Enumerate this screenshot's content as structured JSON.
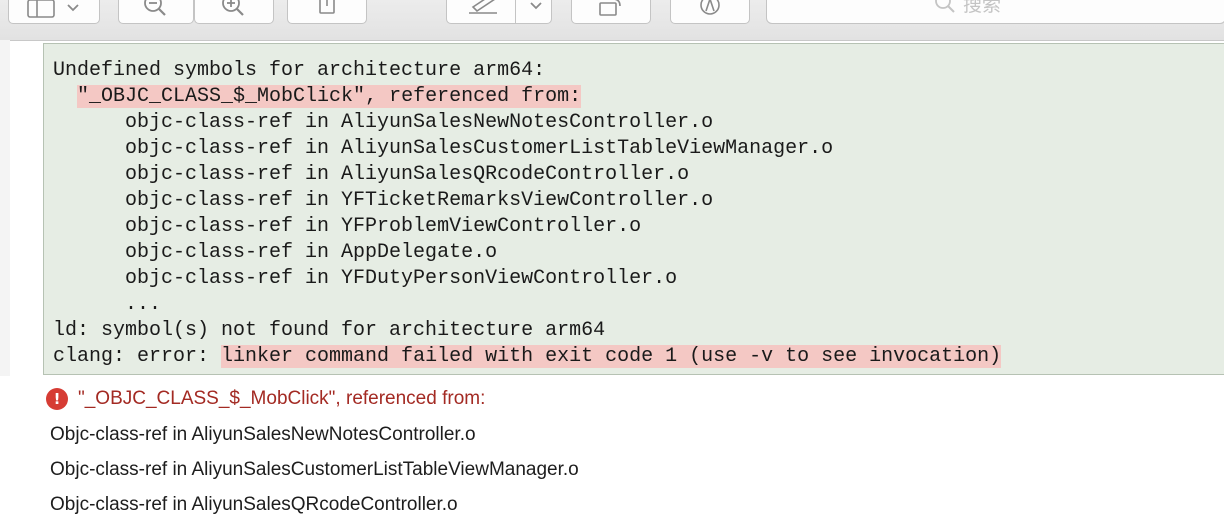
{
  "toolbar": {
    "search_placeholder": "搜索",
    "buttons": [
      "sidebar-toggle",
      "zoom-out",
      "zoom-in",
      "share",
      "markup",
      "rotate",
      "annotate"
    ]
  },
  "console": {
    "lines": [
      "Undefined symbols for architecture arm64:",
      "  \"_OBJC_CLASS_$_MobClick\", referenced from:",
      "      objc-class-ref in AliyunSalesNewNotesController.o",
      "      objc-class-ref in AliyunSalesCustomerListTableViewManager.o",
      "      objc-class-ref in AliyunSalesQRcodeController.o",
      "      objc-class-ref in YFTicketRemarksViewController.o",
      "      objc-class-ref in YFProblemViewController.o",
      "      objc-class-ref in AppDelegate.o",
      "      objc-class-ref in YFDutyPersonViewController.o",
      "      ...",
      "ld: symbol(s) not found for architecture arm64"
    ],
    "symbol_indent": "  ",
    "symbol_line": "\"_OBJC_CLASS_$_MobClick\", referenced from:",
    "error_prefix": "clang: error: ",
    "error_message": "linker command failed with exit code 1 (use -v to see invocation)",
    "highlight_color": "#f4c8c4",
    "background_color": "#e6ede4"
  },
  "issue": {
    "icon": "error-icon",
    "icon_glyph": "!",
    "title": "\"_OBJC_CLASS_$_MobClick\", referenced from:",
    "items": [
      "Objc-class-ref in AliyunSalesNewNotesController.o",
      "Objc-class-ref in AliyunSalesCustomerListTableViewManager.o",
      "Objc-class-ref in AliyunSalesQRcodeController.o"
    ],
    "title_color": "#a32a23",
    "icon_color": "#d63c34"
  }
}
